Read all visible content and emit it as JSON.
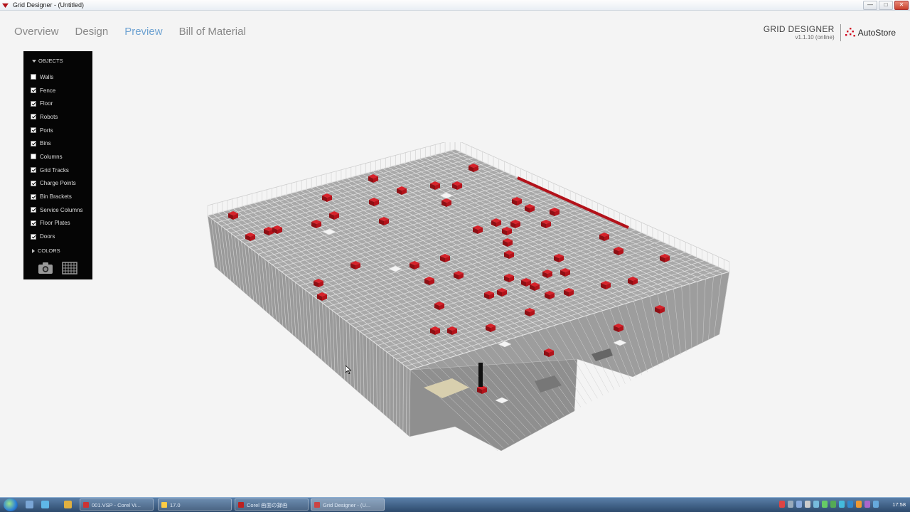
{
  "window": {
    "title": "Grid Designer - (Untitled)",
    "min": "—",
    "max": "□",
    "close": "✕"
  },
  "nav": {
    "tabs": [
      "Overview",
      "Design",
      "Preview",
      "Bill of Material"
    ],
    "active": "Preview"
  },
  "brand": {
    "name": "GRID DESIGNER",
    "version": "v1.1.10 (online)",
    "company": "AutoStore",
    "logo_color": "#d0021b"
  },
  "panel": {
    "objects_label": "OBJECTS",
    "colors_label": "COLORS",
    "items": [
      {
        "label": "Walls",
        "checked": false
      },
      {
        "label": "Fence",
        "checked": true
      },
      {
        "label": "Floor",
        "checked": true
      },
      {
        "label": "Robots",
        "checked": true
      },
      {
        "label": "Ports",
        "checked": true
      },
      {
        "label": "Bins",
        "checked": true
      },
      {
        "label": "Columns",
        "checked": false
      },
      {
        "label": "Grid Tracks",
        "checked": true
      },
      {
        "label": "Charge Points",
        "checked": true
      },
      {
        "label": "Bin Brackets",
        "checked": true
      },
      {
        "label": "Service Columns",
        "checked": true
      },
      {
        "label": "Floor Plates",
        "checked": true
      },
      {
        "label": "Doors",
        "checked": true
      }
    ],
    "tools": [
      "camera-icon",
      "grid-icon"
    ]
  },
  "colors": {
    "robot": "#b3121a",
    "grid_top": "#a9a9a9",
    "grid_side": "#9a9a9a",
    "nav_active": "#6fa3d2"
  },
  "taskbar": {
    "tasks": [
      {
        "label": "001.VSP - Corel Vi...",
        "active": false
      },
      {
        "label": "17.0",
        "active": false
      },
      {
        "label": "Corel 画面の録画",
        "active": false
      },
      {
        "label": "Grid Designer - (U...",
        "active": true
      }
    ],
    "clock": "17:58"
  }
}
